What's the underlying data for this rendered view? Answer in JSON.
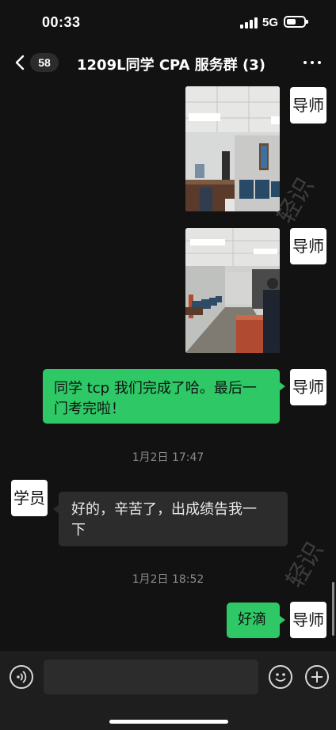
{
  "status_bar": {
    "time": "00:33",
    "network": "5G"
  },
  "nav": {
    "unread_count": "58",
    "title": "1209L同学 CPA 服务群 (3)"
  },
  "messages": [
    {
      "type": "image",
      "sender": "导师",
      "side": "right",
      "description": "office-waiting-room-photo-1"
    },
    {
      "type": "image",
      "sender": "导师",
      "side": "right",
      "description": "office-waiting-room-photo-2"
    },
    {
      "type": "text",
      "sender": "导师",
      "side": "right",
      "lines": [
        "同学 tcp 我们完成了哈。最后一",
        "门考完啦！"
      ]
    },
    {
      "type": "time",
      "text": "1月2日 17:47"
    },
    {
      "type": "text",
      "sender": "学员",
      "side": "left",
      "lines": [
        "好的，辛苦了，出成绩告我一",
        "下"
      ]
    },
    {
      "type": "time",
      "text": "1月2日 18:52"
    },
    {
      "type": "text",
      "sender": "导师",
      "side": "right",
      "lines": [
        "好滴"
      ]
    }
  ],
  "watermark": "轻识",
  "input": {
    "value": "",
    "placeholder": ""
  },
  "icons": [
    "back-chevron-icon",
    "more-icon",
    "voice-icon",
    "emoji-icon",
    "plus-icon"
  ],
  "colors": {
    "sent_bubble": "#2ec866",
    "received_bubble": "#2c2c2c",
    "background": "#121212"
  }
}
